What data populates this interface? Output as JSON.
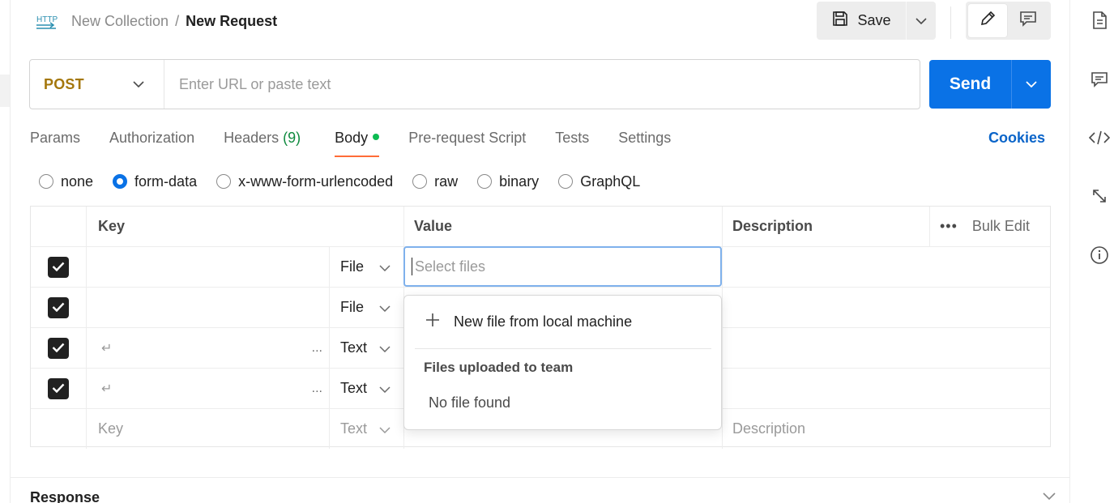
{
  "header": {
    "protocol_badge": "HTTP",
    "collection": "New Collection",
    "separator": "/",
    "request_name": "New Request",
    "save_label": "Save"
  },
  "request": {
    "method": "POST",
    "url_placeholder": "Enter URL or paste text",
    "send_label": "Send",
    "method_color": "#a4770c",
    "send_color": "#0a72e6"
  },
  "tabs": [
    {
      "label": "Params"
    },
    {
      "label": "Authorization"
    },
    {
      "label": "Headers",
      "count": "(9)"
    },
    {
      "label": "Body",
      "selected": true
    },
    {
      "label": "Pre-request Script"
    },
    {
      "label": "Tests"
    },
    {
      "label": "Settings"
    }
  ],
  "cookies_label": "Cookies",
  "body_types": [
    {
      "label": "none",
      "selected": false
    },
    {
      "label": "form-data",
      "selected": true
    },
    {
      "label": "x-www-form-urlencoded",
      "selected": false
    },
    {
      "label": "raw",
      "selected": false
    },
    {
      "label": "binary",
      "selected": false
    },
    {
      "label": "GraphQL",
      "selected": false
    }
  ],
  "table": {
    "headers": {
      "key": "Key",
      "value": "Value",
      "description": "Description",
      "bulk_edit": "Bulk Edit"
    },
    "rows": [
      {
        "checked": true,
        "key": "",
        "type": "File"
      },
      {
        "checked": true,
        "key": "",
        "type": "File"
      },
      {
        "checked": true,
        "key": "↵",
        "type": "Text",
        "more": "..."
      },
      {
        "checked": true,
        "key": "↵",
        "type": "Text",
        "more": "..."
      }
    ],
    "new_row": {
      "key_placeholder": "Key",
      "type": "Text",
      "description_placeholder": "Description"
    },
    "value_placeholder": "Select files"
  },
  "file_dropdown": {
    "new_file_label": "New file from local machine",
    "section_title": "Files uploaded to team",
    "empty_text": "No file found"
  },
  "response": {
    "title": "Response"
  }
}
